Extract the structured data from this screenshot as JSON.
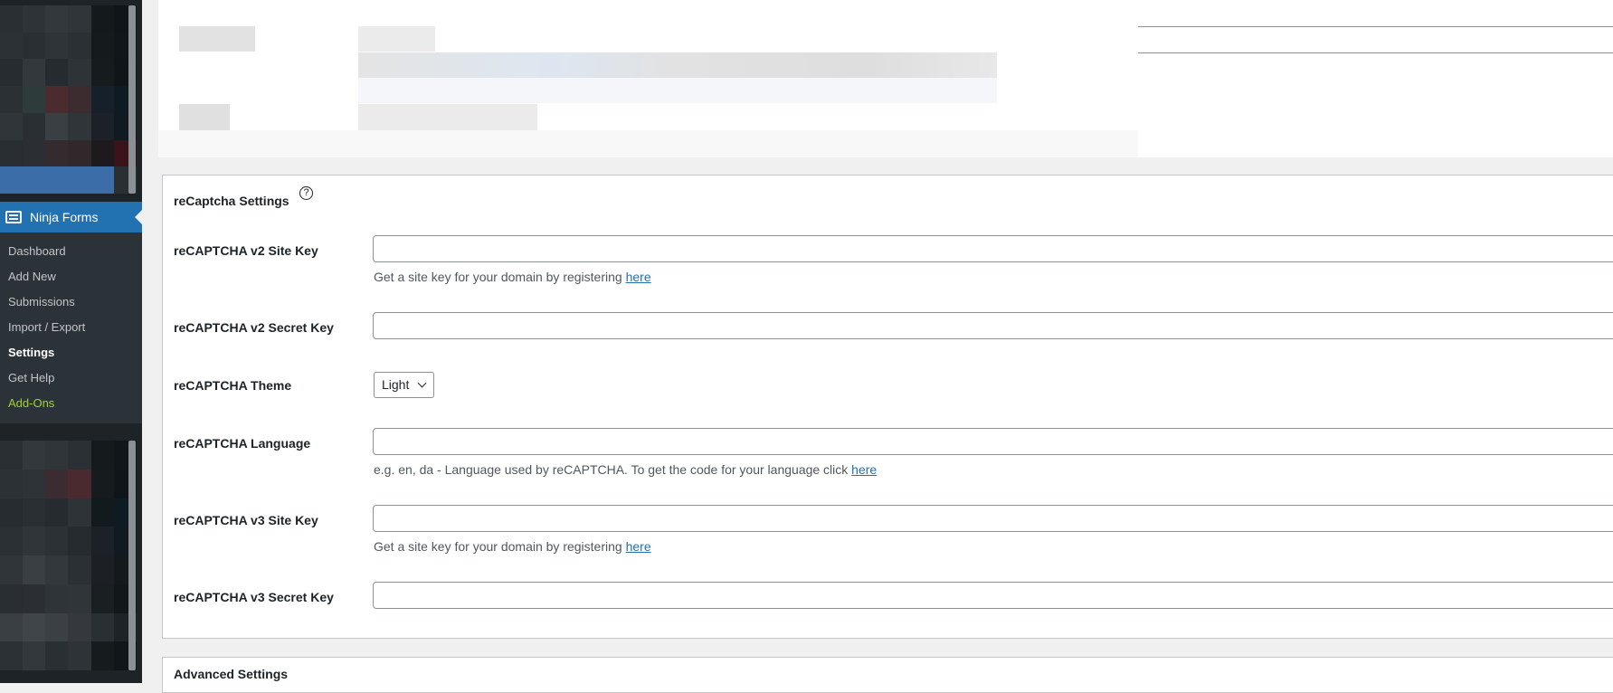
{
  "sidebar": {
    "menu_title": "Ninja Forms",
    "items": [
      {
        "label": "Dashboard"
      },
      {
        "label": "Add New"
      },
      {
        "label": "Submissions"
      },
      {
        "label": "Import / Export"
      },
      {
        "label": "Settings"
      },
      {
        "label": "Get Help"
      },
      {
        "label": "Add-Ons"
      }
    ],
    "current_item": "Settings"
  },
  "recaptcha": {
    "title": "reCaptcha Settings",
    "help_icon_glyph": "?",
    "fields": [
      {
        "label": "reCAPTCHA v2 Site Key",
        "value": "",
        "description": "Get a site key for your domain by registering ",
        "link": "here"
      },
      {
        "label": "reCAPTCHA v2 Secret Key",
        "value": ""
      },
      {
        "label": "reCAPTCHA Theme",
        "selected": "Light"
      },
      {
        "label": "reCAPTCHA Language",
        "value": "",
        "description": "e.g. en, da - Language used by reCAPTCHA. To get the code for your language click ",
        "link": "here"
      },
      {
        "label": "reCAPTCHA v3 Site Key",
        "value": "",
        "description": "Get a site key for your domain by registering ",
        "link": "here"
      },
      {
        "label": "reCAPTCHA v3 Secret Key",
        "value": ""
      }
    ]
  },
  "advanced": {
    "title": "Advanced Settings"
  },
  "colors": {
    "admin_sidebar": "#1d2327",
    "submenu_bg": "#2c3338",
    "accent_blue": "#2271b1",
    "addons_green": "#a0d42a",
    "page_bg": "#f0f0f1"
  },
  "icons": {
    "menu_icon": "ninja-forms-icon",
    "help": "question-circle-icon",
    "select_chevron": "chevron-down-icon"
  }
}
